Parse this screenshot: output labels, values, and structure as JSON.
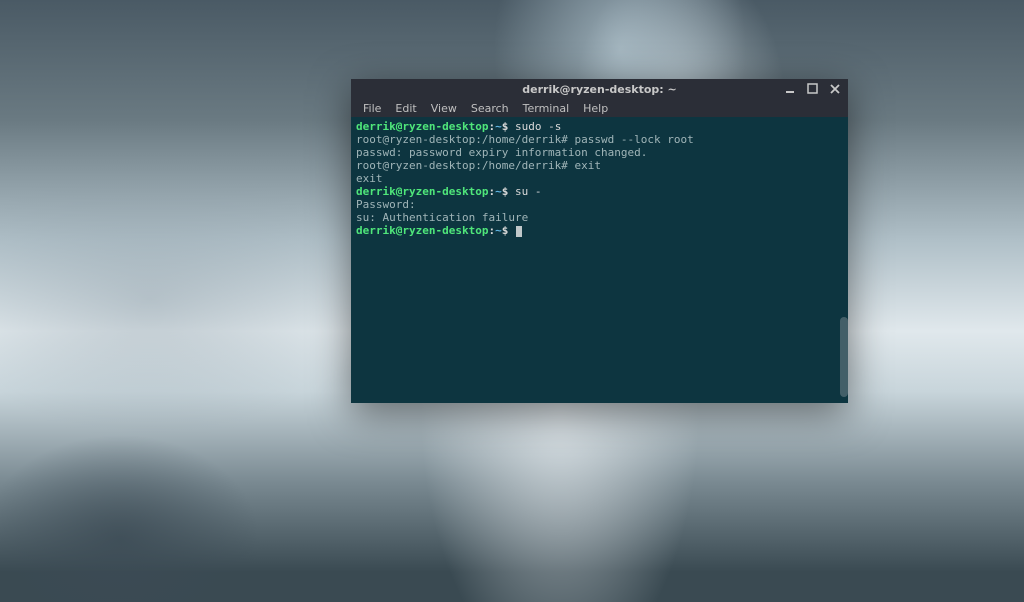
{
  "window": {
    "title": "derrik@ryzen-desktop: ~"
  },
  "menubar": {
    "items": [
      "File",
      "Edit",
      "View",
      "Search",
      "Terminal",
      "Help"
    ]
  },
  "terminal": {
    "lines": [
      {
        "type": "prompt-cmd",
        "user": "derrik@ryzen-desktop",
        "sep": ":",
        "path": "~",
        "sigil": "$ ",
        "cmd": "sudo -s"
      },
      {
        "type": "root-cmd",
        "text": "root@ryzen-desktop:/home/derrik# passwd --lock root"
      },
      {
        "type": "output",
        "text": "passwd: password expiry information changed."
      },
      {
        "type": "root-cmd",
        "text": "root@ryzen-desktop:/home/derrik# exit"
      },
      {
        "type": "output",
        "text": "exit"
      },
      {
        "type": "prompt-cmd",
        "user": "derrik@ryzen-desktop",
        "sep": ":",
        "path": "~",
        "sigil": "$ ",
        "cmd": "su -"
      },
      {
        "type": "output",
        "text": "Password:"
      },
      {
        "type": "output",
        "text": "su: Authentication failure"
      },
      {
        "type": "prompt-cursor",
        "user": "derrik@ryzen-desktop",
        "sep": ":",
        "path": "~",
        "sigil": "$ "
      }
    ]
  }
}
